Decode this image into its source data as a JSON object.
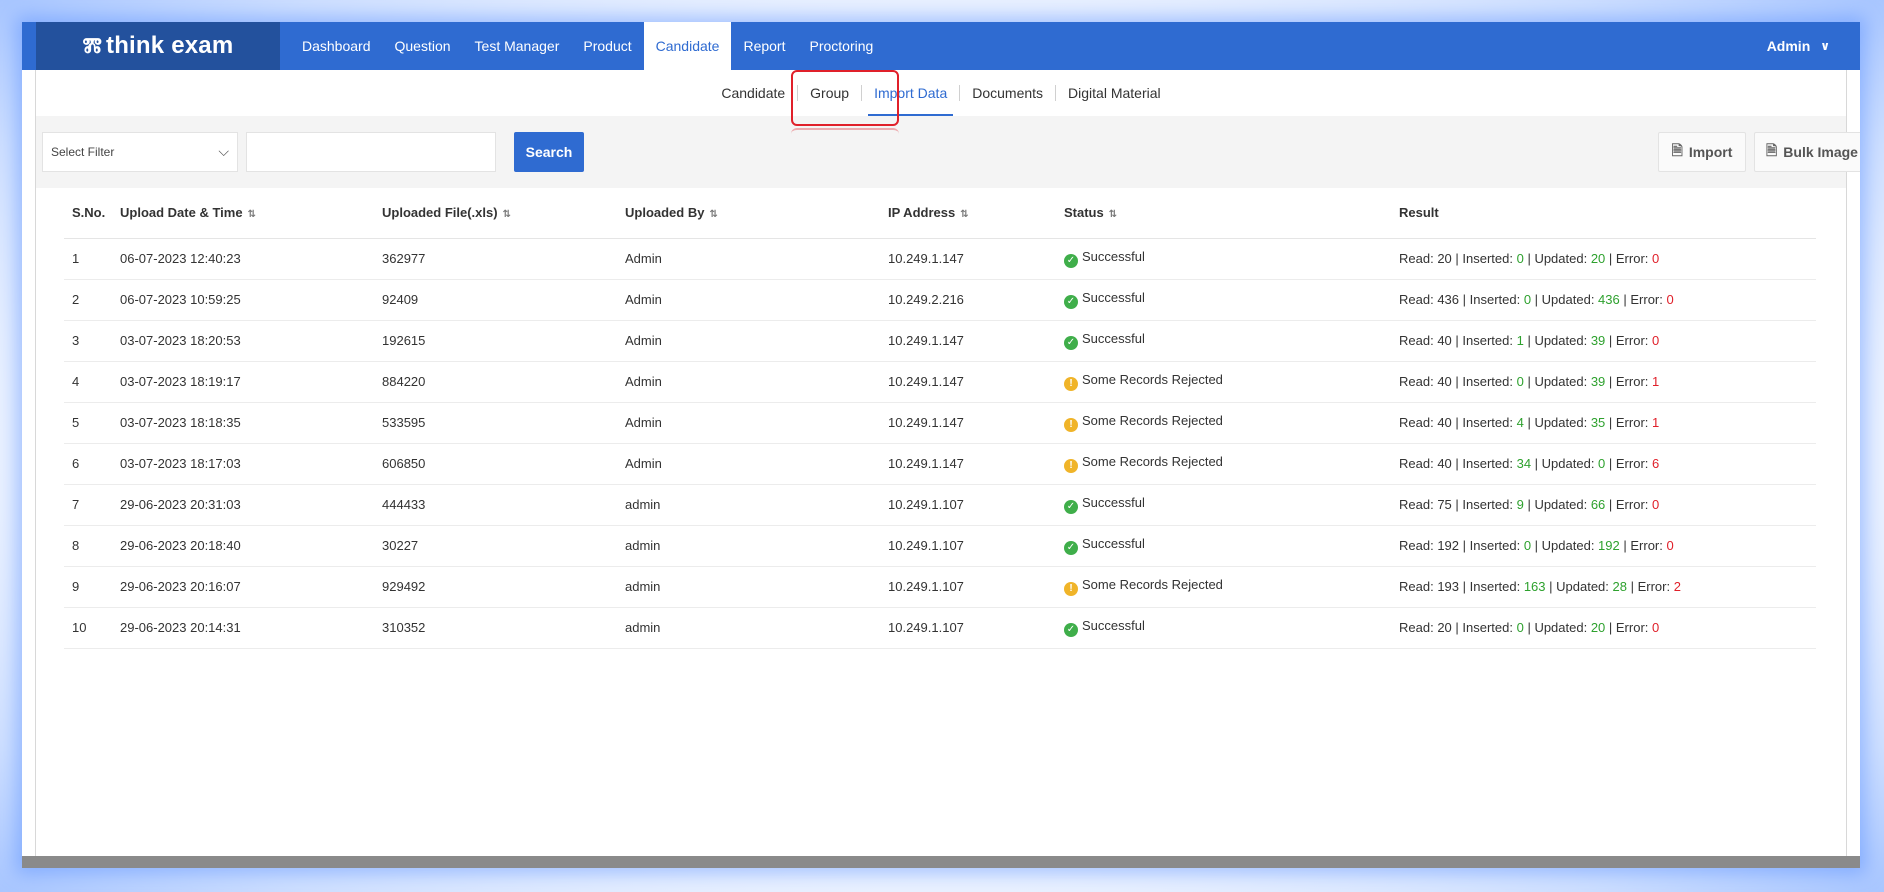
{
  "app": {
    "logo_text": "think exam",
    "user": "Admin"
  },
  "topnav": {
    "items": [
      {
        "label": "Dashboard",
        "active": false
      },
      {
        "label": "Question",
        "active": false
      },
      {
        "label": "Test Manager",
        "active": false
      },
      {
        "label": "Product",
        "active": false
      },
      {
        "label": "Candidate",
        "active": true
      },
      {
        "label": "Report",
        "active": false
      },
      {
        "label": "Proctoring",
        "active": false
      }
    ]
  },
  "subnav": {
    "items": [
      {
        "label": "Candidate",
        "active": false
      },
      {
        "label": "Group",
        "active": false
      },
      {
        "label": "Import Data",
        "active": true
      },
      {
        "label": "Documents",
        "active": false
      },
      {
        "label": "Digital Material",
        "active": false
      }
    ]
  },
  "filter": {
    "select_value": "Select Filter",
    "search_value": "",
    "search_label": "Search",
    "import_label": "Import",
    "bulk_image_label": "Bulk Image"
  },
  "table": {
    "headers": {
      "sno": "S.No.",
      "date": "Upload Date & Time",
      "file": "Uploaded File(.xls)",
      "by": "Uploaded By",
      "ip": "IP Address",
      "status": "Status",
      "result": "Result"
    },
    "labels": {
      "read": "Read: ",
      "inserted": "Inserted: ",
      "updated": "Updated: ",
      "error": "Error: ",
      "sep": " | "
    },
    "rows": [
      {
        "sno": "1",
        "date": "06-07-2023 12:40:23",
        "file": "362977",
        "by": "Admin",
        "ip": "10.249.1.147",
        "status": "Successful",
        "status_type": "ok",
        "read": "20",
        "inserted": "0",
        "updated": "20",
        "error": "0"
      },
      {
        "sno": "2",
        "date": "06-07-2023 10:59:25",
        "file": "92409",
        "by": "Admin",
        "ip": "10.249.2.216",
        "status": "Successful",
        "status_type": "ok",
        "read": "436",
        "inserted": "0",
        "updated": "436",
        "error": "0"
      },
      {
        "sno": "3",
        "date": "03-07-2023 18:20:53",
        "file": "192615",
        "by": "Admin",
        "ip": "10.249.1.147",
        "status": "Successful",
        "status_type": "ok",
        "read": "40",
        "inserted": "1",
        "updated": "39",
        "error": "0"
      },
      {
        "sno": "4",
        "date": "03-07-2023 18:19:17",
        "file": "884220",
        "by": "Admin",
        "ip": "10.249.1.147",
        "status": "Some Records Rejected",
        "status_type": "warn",
        "read": "40",
        "inserted": "0",
        "updated": "39",
        "error": "1"
      },
      {
        "sno": "5",
        "date": "03-07-2023 18:18:35",
        "file": "533595",
        "by": "Admin",
        "ip": "10.249.1.147",
        "status": "Some Records Rejected",
        "status_type": "warn",
        "read": "40",
        "inserted": "4",
        "updated": "35",
        "error": "1"
      },
      {
        "sno": "6",
        "date": "03-07-2023 18:17:03",
        "file": "606850",
        "by": "Admin",
        "ip": "10.249.1.147",
        "status": "Some Records Rejected",
        "status_type": "warn",
        "read": "40",
        "inserted": "34",
        "updated": "0",
        "error": "6"
      },
      {
        "sno": "7",
        "date": "29-06-2023 20:31:03",
        "file": "444433",
        "by": "admin",
        "ip": "10.249.1.107",
        "status": "Successful",
        "status_type": "ok",
        "read": "75",
        "inserted": "9",
        "updated": "66",
        "error": "0"
      },
      {
        "sno": "8",
        "date": "29-06-2023 20:18:40",
        "file": "30227",
        "by": "admin",
        "ip": "10.249.1.107",
        "status": "Successful",
        "status_type": "ok",
        "read": "192",
        "inserted": "0",
        "updated": "192",
        "error": "0"
      },
      {
        "sno": "9",
        "date": "29-06-2023 20:16:07",
        "file": "929492",
        "by": "admin",
        "ip": "10.249.1.107",
        "status": "Some Records Rejected",
        "status_type": "warn",
        "read": "193",
        "inserted": "163",
        "updated": "28",
        "error": "2"
      },
      {
        "sno": "10",
        "date": "29-06-2023 20:14:31",
        "file": "310352",
        "by": "admin",
        "ip": "10.249.1.107",
        "status": "Successful",
        "status_type": "ok",
        "read": "20",
        "inserted": "0",
        "updated": "20",
        "error": "0"
      }
    ]
  },
  "colors": {
    "nav_blue": "#2f6bd1",
    "logo_blue": "#23519d",
    "success_green": "#3fae4a",
    "warning_yellow": "#f0b429",
    "value_green": "#2ea12e",
    "error_red": "#e0202a"
  },
  "icons": {
    "ok": "check-circle-icon",
    "warn": "exclamation-circle-icon",
    "sort": "sort-icon",
    "import": "import-file-icon",
    "bulk_image": "image-file-icon",
    "caret": "chevron-down-icon"
  }
}
